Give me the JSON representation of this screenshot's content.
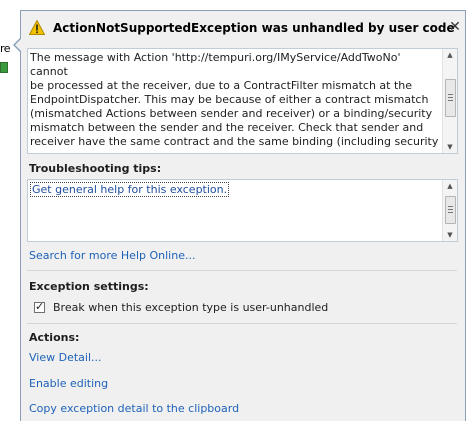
{
  "background": {
    "fragment": "re"
  },
  "dialog": {
    "title": "ActionNotSupportedException was unhandled by user code",
    "message": "The message with Action 'http://tempuri.org/IMyService/AddTwoNo' cannot\nbe processed at the receiver, due to a ContractFilter mismatch at the\nEndpointDispatcher. This may be because of either a contract mismatch\n(mismatched Actions between sender and receiver) or a binding/security\nmismatch between the sender and the receiver.  Check that sender and\nreceiver have the same contract and the same binding (including security",
    "troubleshooting": {
      "heading": "Troubleshooting tips:",
      "tip": "Get general help for this exception."
    },
    "search_online": "Search for more Help Online...",
    "exception_settings": {
      "heading": "Exception settings:",
      "break_label": "Break when this exception type is user-unhandled",
      "break_checked": true
    },
    "actions": {
      "heading": "Actions:",
      "items": [
        "View Detail...",
        "Enable editing",
        "Copy exception detail to the clipboard"
      ]
    }
  },
  "colors": {
    "link": "#1e62b8",
    "border": "#8b9fb8",
    "panel_bg": "#f0f0f0",
    "warning": "#f2c200"
  }
}
